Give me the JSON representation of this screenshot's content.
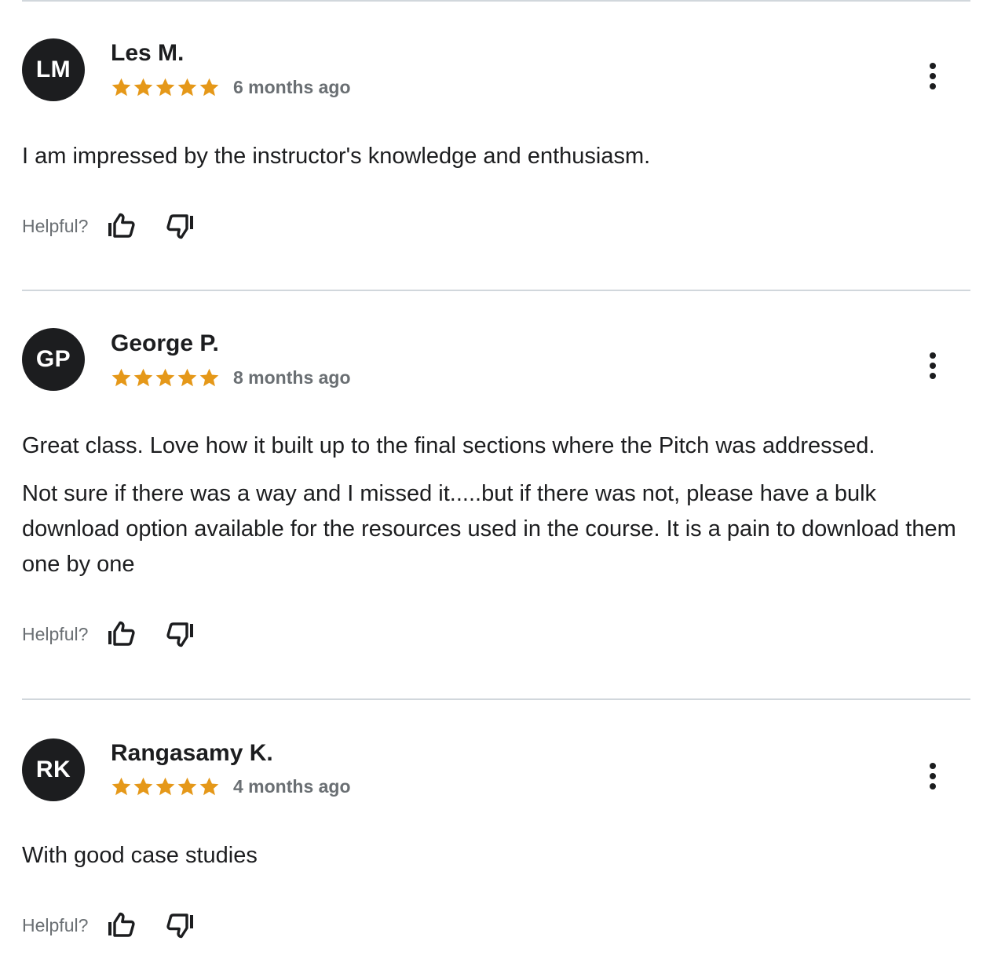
{
  "colors": {
    "avatar_bg": "#1c1d1f",
    "star": "#e59819",
    "muted_text": "#6a6f73",
    "divider": "#d1d7dc"
  },
  "reviews": [
    {
      "initials": "LM",
      "name": "Les M.",
      "rating": 5,
      "time": "6 months ago",
      "paragraphs": [
        "I am impressed by the instructor's knowledge and enthusiasm."
      ],
      "helpful_label": "Helpful?"
    },
    {
      "initials": "GP",
      "name": "George P.",
      "rating": 5,
      "time": "8 months ago",
      "paragraphs": [
        "Great class. Love how it built up to the final sections where the Pitch was addressed.",
        "Not sure if there was a way and I missed it.....but if there was not, please have a bulk download option available for the resources used in the course. It is a pain to download them one by one"
      ],
      "helpful_label": "Helpful?"
    },
    {
      "initials": "RK",
      "name": "Rangasamy K.",
      "rating": 5,
      "time": "4 months ago",
      "paragraphs": [
        "With good case studies"
      ],
      "helpful_label": "Helpful?"
    }
  ]
}
